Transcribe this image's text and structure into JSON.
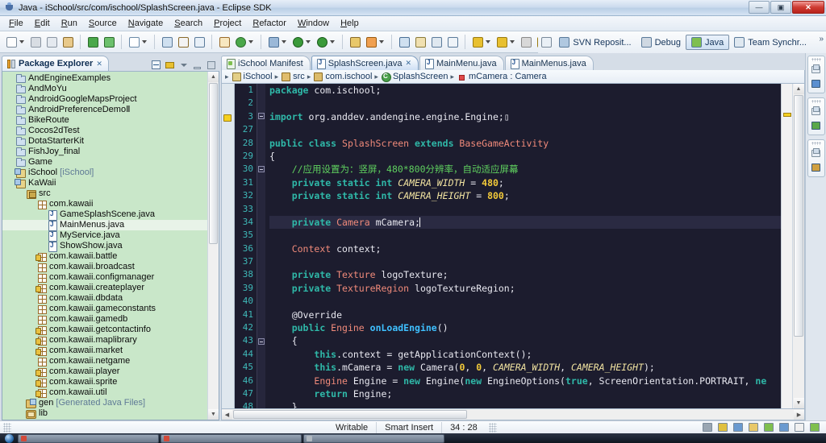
{
  "window": {
    "title": "Java - iSchool/src/com/ischool/SplashScreen.java - Eclipse SDK",
    "minimize": "—",
    "maximize": "▣",
    "close": "✕"
  },
  "menubar": {
    "items": [
      "File",
      "Edit",
      "Run",
      "Source",
      "Navigate",
      "Search",
      "Project",
      "Refactor",
      "Window",
      "Help"
    ]
  },
  "toolbar": {
    "perspectives": [
      {
        "label": "SVN Reposit...",
        "icon": "svn-repository-icon",
        "active": false
      },
      {
        "label": "Debug",
        "icon": "debug-icon",
        "active": false
      },
      {
        "label": "Java",
        "icon": "java-perspective-icon",
        "active": true
      },
      {
        "label": "Team Synchr...",
        "icon": "team-sync-icon",
        "active": false
      }
    ],
    "open_perspective_icon": "open-perspective-icon",
    "overflow": "»"
  },
  "package_explorer": {
    "tab_title": "Package Explorer",
    "tab_close": "✕",
    "tools": [
      "collapse-all-icon",
      "link-with-editor-icon",
      "view-menu-icon",
      "minimize-icon",
      "maximize-icon"
    ],
    "tree": [
      {
        "label": "AndEngineExamples",
        "icon": "folder",
        "indent": 1
      },
      {
        "label": "AndMoYu",
        "icon": "folder",
        "indent": 1
      },
      {
        "label": "AndroidGoogleMapsProject",
        "icon": "folder",
        "indent": 1
      },
      {
        "label": "AndroidPreferenceDemoⅡ",
        "icon": "folder",
        "indent": 1
      },
      {
        "label": "BikeRoute",
        "icon": "folder",
        "indent": 1
      },
      {
        "label": "Cocos2dTest",
        "icon": "folder",
        "indent": 1
      },
      {
        "label": "DotaStarterKit",
        "icon": "folder",
        "indent": 1
      },
      {
        "label": "FishJoy_final",
        "icon": "folder",
        "indent": 1
      },
      {
        "label": "Game",
        "icon": "folder",
        "indent": 1
      },
      {
        "label": "iSchool",
        "suffix": " [iSchool]",
        "icon": "java-project",
        "indent": 1
      },
      {
        "label": "KaWaii",
        "icon": "java-project",
        "indent": 1
      },
      {
        "label": "src",
        "icon": "source-folder",
        "indent": 2
      },
      {
        "label": "com.kawaii",
        "icon": "package",
        "indent": 3
      },
      {
        "label": "GameSplashScene.java",
        "icon": "java-file",
        "indent": 4
      },
      {
        "label": "MainMenus.java",
        "icon": "java-file",
        "indent": 4,
        "selected": true
      },
      {
        "label": "MyService.java",
        "icon": "java-file",
        "indent": 4
      },
      {
        "label": "ShowShow.java",
        "icon": "java-file",
        "indent": 4
      },
      {
        "label": "com.kawaii.battle",
        "icon": "package-locked",
        "indent": 3
      },
      {
        "label": "com.kawaii.broadcast",
        "icon": "package",
        "indent": 3
      },
      {
        "label": "com.kawaii.configmanager",
        "icon": "package",
        "indent": 3
      },
      {
        "label": "com.kawaii.createplayer",
        "icon": "package-locked",
        "indent": 3
      },
      {
        "label": "com.kawaii.dbdata",
        "icon": "package",
        "indent": 3
      },
      {
        "label": "com.kawaii.gameconstants",
        "icon": "package",
        "indent": 3
      },
      {
        "label": "com.kawaii.gamedb",
        "icon": "package",
        "indent": 3
      },
      {
        "label": "com.kawaii.getcontactinfo",
        "icon": "package-locked",
        "indent": 3
      },
      {
        "label": "com.kawaii.maplibrary",
        "icon": "package-locked",
        "indent": 3
      },
      {
        "label": "com.kawaii.market",
        "icon": "package-locked",
        "indent": 3
      },
      {
        "label": "com.kawaii.netgame",
        "icon": "package",
        "indent": 3
      },
      {
        "label": "com.kawaii.player",
        "icon": "package-locked",
        "indent": 3
      },
      {
        "label": "com.kawaii.sprite",
        "icon": "package-locked",
        "indent": 3
      },
      {
        "label": "com.kawaii.util",
        "icon": "package-locked",
        "indent": 3
      },
      {
        "label": "gen",
        "suffix": " [Generated Java Files]",
        "icon": "gen-folder",
        "indent": 2
      },
      {
        "label": "lib",
        "icon": "lib-folder",
        "indent": 2
      }
    ]
  },
  "editor": {
    "tabs": [
      {
        "label": "iSchool Manifest",
        "icon": "manifest",
        "active": false,
        "closable": false
      },
      {
        "label": "SplashScreen.java",
        "icon": "java",
        "active": true,
        "closable": true,
        "close": "✕"
      },
      {
        "label": "MainMenu.java",
        "icon": "java",
        "active": false,
        "closable": false
      },
      {
        "label": "MainMenus.java",
        "icon": "java",
        "active": false,
        "closable": false
      }
    ],
    "breadcrumb": [
      {
        "label": "iSchool",
        "icon": "proj"
      },
      {
        "label": "src",
        "icon": "pkgroot"
      },
      {
        "label": "com.ischool",
        "icon": "pkg"
      },
      {
        "label": "SplashScreen",
        "icon": "cls"
      },
      {
        "label": "mCamera : Camera",
        "icon": "field"
      }
    ],
    "breadcrumb_sep": "▸",
    "first_line_number": 1,
    "line_numbers": [
      1,
      2,
      3,
      27,
      28,
      29,
      30,
      31,
      32,
      33,
      34,
      35,
      36,
      37,
      38,
      39,
      40,
      41,
      42,
      43,
      44,
      45,
      46,
      47,
      48
    ],
    "cursor_line_index": 10,
    "code": [
      [
        {
          "t": "package ",
          "c": "k"
        },
        {
          "t": "com.ischool;",
          "c": "pl"
        }
      ],
      [],
      [
        {
          "t": "import ",
          "c": "k"
        },
        {
          "t": "org.anddev.andengine.engine.Engine;",
          "c": "pl"
        },
        {
          "t": "▯",
          "c": "pl"
        }
      ],
      [],
      [
        {
          "t": "public ",
          "c": "k"
        },
        {
          "t": "class ",
          "c": "k"
        },
        {
          "t": "SplashScreen ",
          "c": "ty"
        },
        {
          "t": "extends ",
          "c": "k"
        },
        {
          "t": "BaseGameActivity",
          "c": "ty"
        }
      ],
      [
        {
          "t": "{",
          "c": "pl"
        }
      ],
      [
        {
          "t": "    //应用设置为：竖屏，480*800分辨率，自动适应屏幕",
          "c": "cm"
        }
      ],
      [
        {
          "t": "    ",
          "c": "pl"
        },
        {
          "t": "private static int ",
          "c": "k"
        },
        {
          "t": "CAMERA_WIDTH",
          "c": "fld"
        },
        {
          "t": " = ",
          "c": "pl"
        },
        {
          "t": "480",
          "c": "num"
        },
        {
          "t": ";",
          "c": "pl"
        }
      ],
      [
        {
          "t": "    ",
          "c": "pl"
        },
        {
          "t": "private static int ",
          "c": "k"
        },
        {
          "t": "CAMERA_HEIGHT",
          "c": "fld"
        },
        {
          "t": " = ",
          "c": "pl"
        },
        {
          "t": "800",
          "c": "num"
        },
        {
          "t": ";",
          "c": "pl"
        }
      ],
      [],
      [
        {
          "t": "    ",
          "c": "pl"
        },
        {
          "t": "private ",
          "c": "k"
        },
        {
          "t": "Camera ",
          "c": "ty"
        },
        {
          "t": "mCamera;",
          "c": "pl"
        }
      ],
      [],
      [
        {
          "t": "    ",
          "c": "pl"
        },
        {
          "t": "Context ",
          "c": "ty"
        },
        {
          "t": "context;",
          "c": "pl"
        }
      ],
      [],
      [
        {
          "t": "    ",
          "c": "pl"
        },
        {
          "t": "private ",
          "c": "k"
        },
        {
          "t": "Texture ",
          "c": "ty"
        },
        {
          "t": "logoTexture;",
          "c": "pl"
        }
      ],
      [
        {
          "t": "    ",
          "c": "pl"
        },
        {
          "t": "private ",
          "c": "k"
        },
        {
          "t": "TextureRegion ",
          "c": "ty"
        },
        {
          "t": "logoTextureRegion;",
          "c": "pl"
        }
      ],
      [],
      [
        {
          "t": "    @Override",
          "c": "anno"
        }
      ],
      [
        {
          "t": "    ",
          "c": "pl"
        },
        {
          "t": "public ",
          "c": "k"
        },
        {
          "t": "Engine ",
          "c": "ty"
        },
        {
          "t": "onLoadEngine",
          "c": "kb"
        },
        {
          "t": "()",
          "c": "pl"
        }
      ],
      [
        {
          "t": "    {",
          "c": "pl"
        }
      ],
      [
        {
          "t": "        ",
          "c": "pl"
        },
        {
          "t": "this",
          "c": "k"
        },
        {
          "t": ".context = getApplicationContext();",
          "c": "pl"
        }
      ],
      [
        {
          "t": "        ",
          "c": "pl"
        },
        {
          "t": "this",
          "c": "k"
        },
        {
          "t": ".mCamera = ",
          "c": "pl"
        },
        {
          "t": "new ",
          "c": "k"
        },
        {
          "t": "Camera(",
          "c": "pl"
        },
        {
          "t": "0",
          "c": "num"
        },
        {
          "t": ", ",
          "c": "pl"
        },
        {
          "t": "0",
          "c": "num"
        },
        {
          "t": ", ",
          "c": "pl"
        },
        {
          "t": "CAMERA_WIDTH",
          "c": "fld"
        },
        {
          "t": ", ",
          "c": "pl"
        },
        {
          "t": "CAMERA_HEIGHT",
          "c": "fld"
        },
        {
          "t": ");",
          "c": "pl"
        }
      ],
      [
        {
          "t": "        ",
          "c": "pl"
        },
        {
          "t": "Engine ",
          "c": "ty"
        },
        {
          "t": "Engine = ",
          "c": "pl"
        },
        {
          "t": "new ",
          "c": "k"
        },
        {
          "t": "Engine(",
          "c": "pl"
        },
        {
          "t": "new ",
          "c": "k"
        },
        {
          "t": "EngineOptions(",
          "c": "pl"
        },
        {
          "t": "true",
          "c": "k"
        },
        {
          "t": ", ScreenOrientation.PORTRAIT, ",
          "c": "pl"
        },
        {
          "t": "ne",
          "c": "k"
        }
      ],
      [
        {
          "t": "        ",
          "c": "pl"
        },
        {
          "t": "return ",
          "c": "k"
        },
        {
          "t": "Engine;",
          "c": "pl"
        }
      ],
      [
        {
          "t": "    }",
          "c": "pl"
        }
      ]
    ]
  },
  "right_bar": {
    "stacks": [
      {
        "restore_icon": "restore-view-icon",
        "view_icon": "outline-icon"
      },
      {
        "restore_icon": "restore-view-icon",
        "view_icon": "console-icon"
      },
      {
        "restore_icon": "restore-view-icon",
        "view_icon": "properties-icon"
      }
    ]
  },
  "statusbar": {
    "writable": "Writable",
    "insert_mode": "Smart Insert",
    "position": "34 : 28",
    "right_icons": [
      "print-icon",
      "lock-icon",
      "at-icon",
      "copy-icon",
      "new-icon",
      "comment-icon",
      "junit-icon",
      "android-icon"
    ]
  },
  "taskbar": {
    "start": "start-orb",
    "tasks": [
      "task-1",
      "task-2",
      "task-3"
    ]
  }
}
